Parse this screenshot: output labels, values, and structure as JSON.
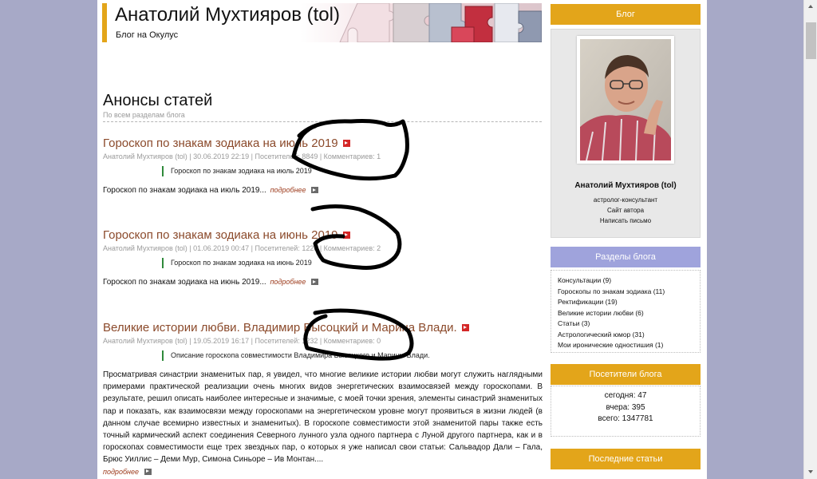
{
  "header": {
    "title": "Анатолий Мухтияров (tol)",
    "subtitle": "Блог на Окулус"
  },
  "section": {
    "title": "Анонсы статей",
    "subtitle": "По всем разделам блога"
  },
  "posts": [
    {
      "title": "Гороскоп по знакам зодиака на июль 2019",
      "meta": "Анатолий Мухтияров (tol) | 30.06.2019 22:19 | Посетителей: 8849 | Комментариев: 1",
      "quote": "Гороскоп по знакам зодиака на июль 2019",
      "text": "Гороскоп по знакам зодиака на июль 2019...",
      "more": "подробнее"
    },
    {
      "title": "Гороскоп по знакам зодиака на июнь 2019",
      "meta": "Анатолий Мухтияров (tol) | 01.06.2019 00:47 | Посетителей: 1228 | Комментариев: 2",
      "quote": "Гороскоп по знакам зодиака на июнь 2019",
      "text": "Гороскоп по знакам зодиака на июнь 2019...",
      "more": "подробнее"
    },
    {
      "title": "Великие истории любви. Владимир Высоцкий и Марина Влади.",
      "meta": "Анатолий Мухтияров (tol) | 19.05.2019 16:17 | Посетителей: 1232 | Комментариев: 0",
      "quote": "Описание гороскопа совместимости Владимира Высоцкого и Марины Влади.",
      "text": "Просматривая синастрии знаменитых пар, я увидел, что многие великие истории любви могут служить наглядными примерами практической реализации очень многих видов энергетических взаимосвязей между гороскопами. В результате, решил описать наиболее интересные и значимые, с моей точки зрения, элементы синастрий знаменитых пар и показать, как взаимосвязи между гороскопами на энергетическом уровне могут проявиться в жизни людей (в данном случае всемирно известных и знаменитых). В гороскопе совместимости этой знаменитой пары также есть точный кармический аспект соединения Северного лунного узла одного партнера с Луной другого партнера, как и в гороскопах совместимости еще трех звездных пар, о которых я уже написал свои статьи: Сальвадор Дали – Гала, Брюс Уиллис – Деми Мур, Симона Синьоре – Ив Монтан....",
      "more": "подробнее"
    }
  ],
  "sidebar": {
    "blog_label": "Блог",
    "author_name": "Анатолий Мухтияров (tol)",
    "author_role": "астролог-консультант",
    "author_site": "Сайт автора",
    "author_write": "Написать письмо",
    "sections_label": "Разделы блога",
    "sections": [
      "Консультации (9)",
      "Гороскопы по знакам зодиака (11)",
      "Ректификации (19)",
      "Великие истории любви (6)",
      "Статьи (3)",
      "Астрологический юмор (31)",
      "Мои иронические одностишия (1)"
    ],
    "visitors_label": "Посетители блога",
    "visitors": {
      "today": "сегодня: 47",
      "yesterday": "вчера: 395",
      "total": "всего: 1347781"
    },
    "latest_label": "Последние статьи"
  },
  "colors": {
    "accent_orange": "#e3a51a",
    "accent_blue": "#9fa3dc",
    "link_brown": "#8b4a2b",
    "quote_green": "#2f8a3a"
  }
}
